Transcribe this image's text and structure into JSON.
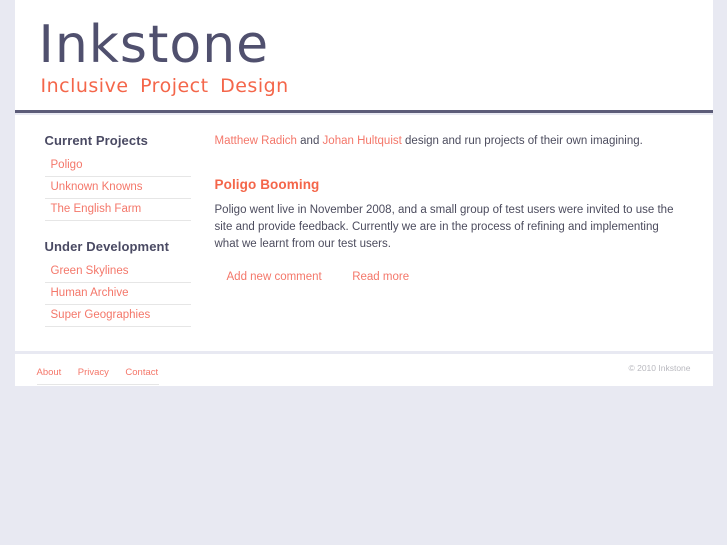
{
  "site": {
    "logo_word": "Inkstone",
    "tagline": "Inclusive Project Design"
  },
  "sidebar": {
    "sections": [
      {
        "heading": "Current Projects",
        "items": [
          {
            "label": "Poligo"
          },
          {
            "label": "Unknown Knowns"
          },
          {
            "label": "The English Farm"
          }
        ]
      },
      {
        "heading": "Under Development",
        "items": [
          {
            "label": "Green Skylines"
          },
          {
            "label": "Human Archive"
          },
          {
            "label": "Super Geographies"
          }
        ]
      }
    ]
  },
  "main": {
    "intro": {
      "person_one": "Matthew Radich",
      "conjunction": " and ",
      "person_two": "Johan Hultquist",
      "tail": " design and run projects of their own imagining."
    },
    "post": {
      "title": "Poligo Booming",
      "body": "Poligo went live in November 2008, and a small group of test users were invited to use the site and provide feedback. Currently we are in the process of refining and implementing what we learnt from our test users.",
      "links": [
        {
          "label": "Add new comment"
        },
        {
          "label": "Read more"
        }
      ]
    }
  },
  "footer": {
    "links": [
      {
        "label": "About"
      },
      {
        "label": "Privacy"
      },
      {
        "label": "Contact"
      }
    ],
    "copyright": "© 2010 Inkstone"
  },
  "colors": {
    "accent": "#f4664a",
    "link": "#f4776a",
    "ink": "#50506e",
    "body_text": "#4c4c5e",
    "page_background": "#e8e9f2",
    "rule": "#5c5c78"
  }
}
